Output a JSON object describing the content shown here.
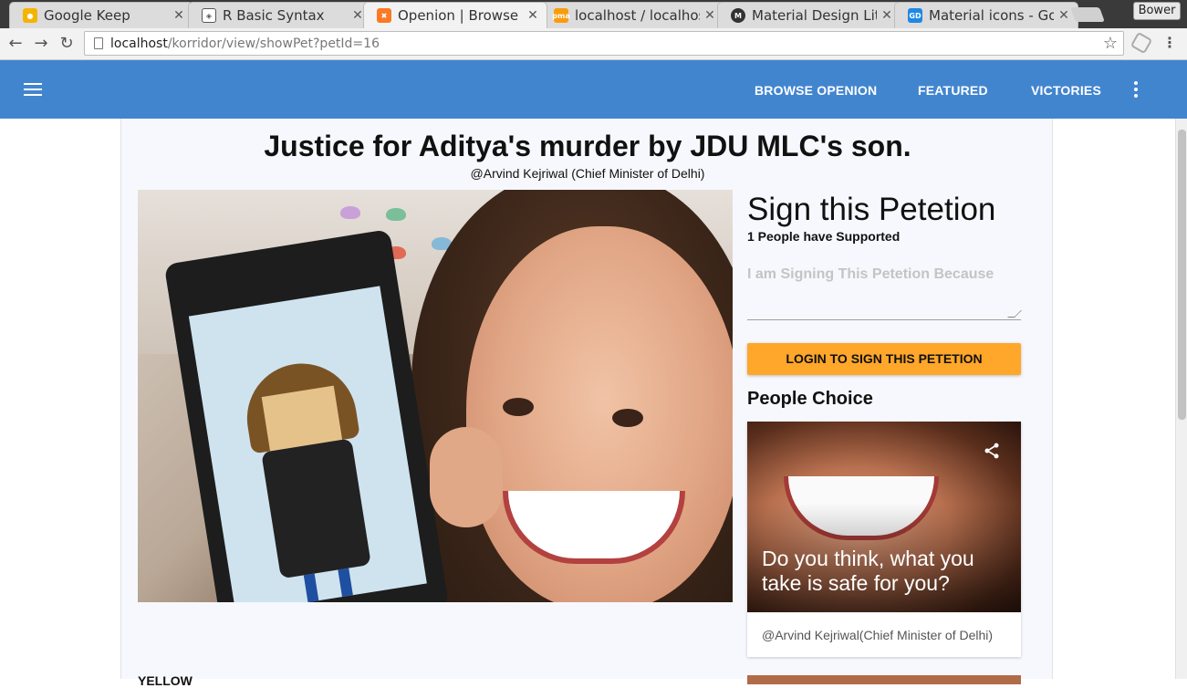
{
  "browser": {
    "tabs": [
      {
        "label": "Google Keep",
        "icon": "keep-bulb-icon",
        "color": "#f4b400"
      },
      {
        "label": "R Basic Syntax",
        "icon": "tutorials-point-icon",
        "color": "#555555"
      },
      {
        "label": "Openion | Browse A",
        "icon": "xampp-icon",
        "color": "#fb7a24"
      },
      {
        "label": "localhost / localhos",
        "icon": "phpmyadmin-icon",
        "color": "#f89c0e"
      },
      {
        "label": "Material Design Lit",
        "icon": "material-lite-icon",
        "color": "#333333"
      },
      {
        "label": "Material icons - Goo",
        "icon": "google-design-icon",
        "color": "#1e88e5"
      }
    ],
    "profile_name": "Bower",
    "url_host": "localhost",
    "url_path": "/korridor/view/showPet?petId=16"
  },
  "appbar": {
    "color": "#4285cf",
    "links": [
      "BROWSE OPENION",
      "FEATURED",
      "VICTORIES"
    ]
  },
  "petition": {
    "title": "Justice for Aditya's murder by JDU MLC's son.",
    "author": "@Arvind Kejriwal (Chief Minister of Delhi)",
    "below_text": "YELLOW"
  },
  "sign": {
    "title": "Sign this Petetion",
    "supporters": "1 People have Supported",
    "reason_placeholder": "I am Signing This Petetion Because",
    "login_button": "LOGIN TO SIGN THIS PETETION",
    "button_color": "#ffa72a"
  },
  "people_choice": {
    "heading": "People Choice",
    "caption": "Do you think, what you take is safe for you?",
    "author": "@Arvind Kejriwal(Chief Minister of Delhi)"
  }
}
